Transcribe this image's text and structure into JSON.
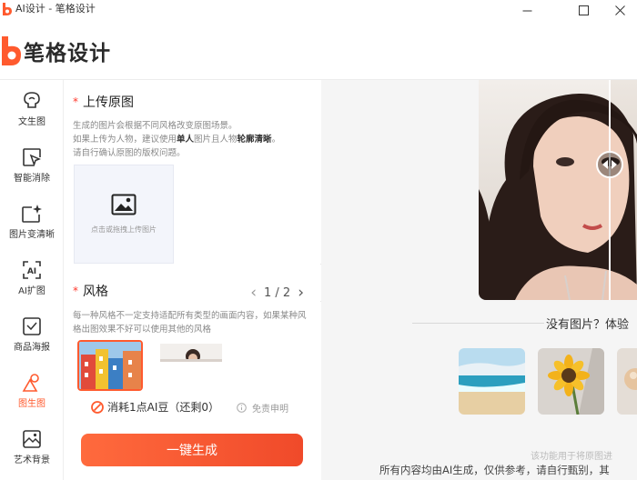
{
  "window": {
    "title": "AI设计 - 笔格设计",
    "minimize_symbol": "—",
    "maximize_symbol": "☐",
    "close_symbol": "✕"
  },
  "brand": {
    "name": "笔格设计",
    "accent": "#ff5a2e"
  },
  "sidebar": {
    "items": [
      {
        "label": "文生图",
        "icon": "brain-bulb-icon",
        "active": false
      },
      {
        "label": "智能消除",
        "icon": "eraser-cursor-icon",
        "active": false
      },
      {
        "label": "图片变清晰",
        "icon": "sparkle-frame-icon",
        "active": false
      },
      {
        "label": "AI扩图",
        "icon": "ai-expand-icon",
        "active": false
      },
      {
        "label": "商品海报",
        "icon": "poster-icon",
        "active": false
      },
      {
        "label": "图生图",
        "icon": "shapes-icon",
        "active": true
      },
      {
        "label": "艺术背景",
        "icon": "landscape-icon",
        "active": false
      }
    ]
  },
  "panel": {
    "upload_title": "上传原图",
    "upload_desc_1": "生成的图片会根据不同风格改变原图场景。",
    "upload_desc_2_prefix": "如果上传为人物，建议使用",
    "upload_desc_2_bold1": "单人",
    "upload_desc_2_mid": "图片且人物",
    "upload_desc_2_bold2": "轮廓清晰",
    "upload_desc_2_suffix": "。",
    "upload_desc_3": "请自行确认原图的版权问题。",
    "upload_hint": "点击或拖拽上传图片",
    "style_title": "风格",
    "pager": {
      "prev": "‹",
      "text": "1 / 2",
      "next": "›"
    },
    "style_desc": "每一种风格不一定支持适配所有类型的画面内容，如果某种风格出图效果不好可以使用其他的风格",
    "cost_text": "消耗1点AI豆（还剩0）",
    "disclaimer": "免责申明",
    "generate_button": "一键生成"
  },
  "preview": {
    "no_image_text": "没有图片？体验",
    "footer_notice_partial": "该功能用于将原图进",
    "footer_notice": "所有内容均由AI生成，仅供参考，请自行甄别，其"
  }
}
